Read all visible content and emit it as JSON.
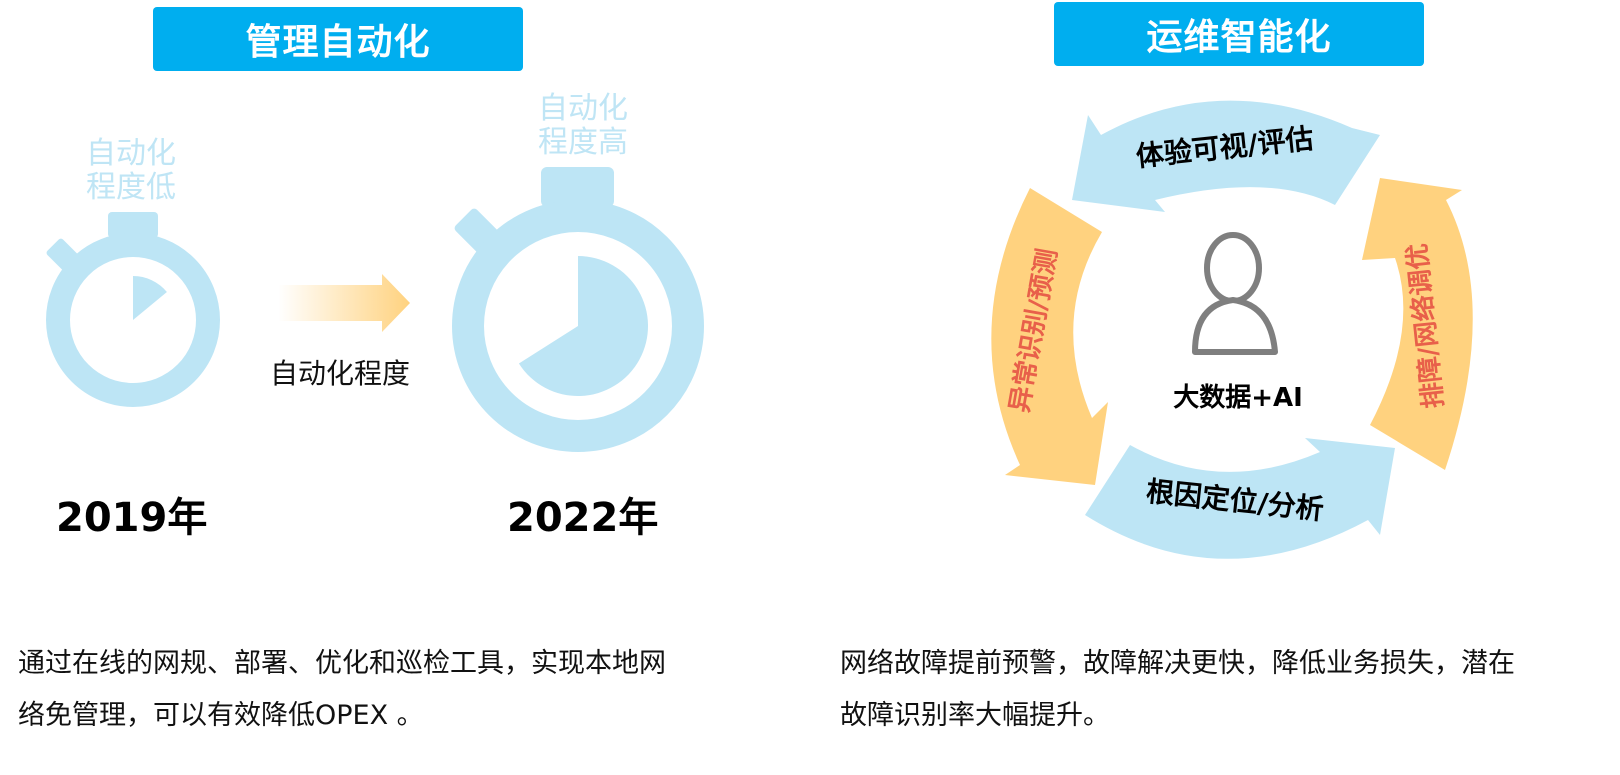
{
  "left": {
    "title": "管理自动化",
    "label_low_1": "自动化",
    "label_low_2": "程度低",
    "label_high_1": "自动化",
    "label_high_2": "程度高",
    "arrow_label": "自动化程度",
    "year_left": "2019年",
    "year_right": "2022年",
    "description_1": "通过在线的网规、部署、优化和巡检工具，实现本地网",
    "description_2": "络免管理，可以有效降低OPEX 。",
    "automation_level_2019": 0.14,
    "automation_level_2022": 0.66
  },
  "right": {
    "title": "运维智能化",
    "cycle_top": "体验可视/评估",
    "cycle_right": "排障/网络调优",
    "cycle_bottom": "根因定位/分析",
    "cycle_left": "异常识别/预测",
    "center_label": "大数据+AI",
    "description_1": "网络故障提前预警，故障解决更快，降低业务损失，潜在",
    "description_2": "故障识别率大幅提升。"
  },
  "colors": {
    "banner": "#00AEEF",
    "light_blue": "#BDE5F5",
    "orange": "#FFD27F",
    "red_text": "#E8604A",
    "person_gray": "#7F7F7F"
  }
}
